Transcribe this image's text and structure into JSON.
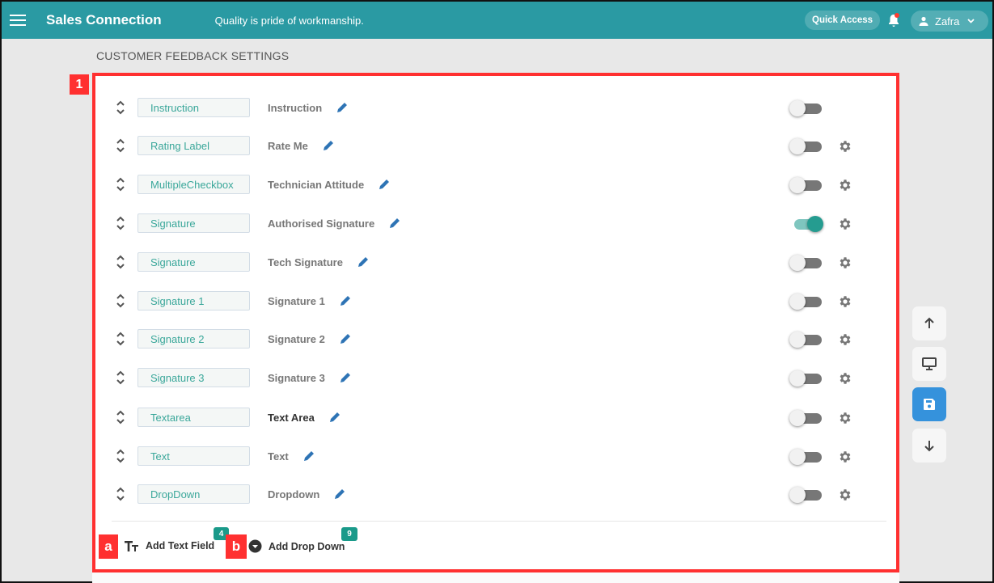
{
  "topbar": {
    "menu_icon": "hamburger-menu-icon",
    "brand": "Sales Connection",
    "tagline": "Quality is pride of workmanship.",
    "quick_access": "Quick Access",
    "notification_icon": "bell-icon",
    "notification_dot_color": "#ff3b30",
    "user_icon": "person-icon",
    "user_name": "Zafra",
    "user_menu_icon": "chevron-down-icon",
    "color": "#2a9aa3"
  },
  "page": {
    "title": "CUSTOMER FEEDBACK SETTINGS"
  },
  "annotations": {
    "panel_marker": "1",
    "marker_a": "a",
    "marker_b": "b",
    "color": "#ff3030"
  },
  "fields": [
    {
      "type": "Instruction",
      "label": "Instruction",
      "enabled": false,
      "has_settings": false
    },
    {
      "type": "Rating Label",
      "label": "Rate Me",
      "enabled": false,
      "has_settings": true
    },
    {
      "type": "MultipleCheckbox",
      "label": "Technician Attitude",
      "enabled": false,
      "has_settings": true
    },
    {
      "type": "Signature",
      "label": "Authorised Signature",
      "enabled": true,
      "has_settings": true
    },
    {
      "type": "Signature",
      "label": "Tech Signature",
      "enabled": false,
      "has_settings": true
    },
    {
      "type": "Signature 1",
      "label": "Signature 1",
      "enabled": false,
      "has_settings": true
    },
    {
      "type": "Signature 2",
      "label": "Signature 2",
      "enabled": false,
      "has_settings": true
    },
    {
      "type": "Signature 3",
      "label": "Signature 3",
      "enabled": false,
      "has_settings": true
    },
    {
      "type": "Textarea",
      "label": "Text Area",
      "enabled": false,
      "has_settings": true
    },
    {
      "type": "Text",
      "label": "Text",
      "enabled": false,
      "has_settings": true
    },
    {
      "type": "DropDown",
      "label": "Dropdown",
      "enabled": false,
      "has_settings": true
    }
  ],
  "footer": {
    "add_text_field": {
      "label": "Add Text Field",
      "icon": "text-size-icon",
      "badge": "4"
    },
    "add_drop_down": {
      "label": "Add Drop Down",
      "icon": "dropdown-circle-icon",
      "badge": "9"
    }
  },
  "side_actions": [
    {
      "name": "scroll-up-button",
      "icon": "arrow-up-icon"
    },
    {
      "name": "preview-button",
      "icon": "monitor-icon"
    },
    {
      "name": "save-button",
      "icon": "save-icon"
    },
    {
      "name": "scroll-down-button",
      "icon": "arrow-down-icon"
    }
  ]
}
